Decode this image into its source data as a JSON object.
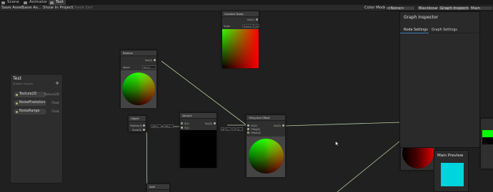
{
  "tabs": [
    {
      "label": "Scene"
    },
    {
      "label": "Animator"
    },
    {
      "label": "Test"
    }
  ],
  "toolbar": {
    "save_asset": "Save Asset",
    "save_as": "Save As...",
    "show_in_project": "Show In Project",
    "check_out": "Check Out",
    "color_mode_label": "Color Mode",
    "color_mode_value": "<None>",
    "blackboard": "Blackboard",
    "graph_inspector": "Graph Inspector",
    "main_preview": "Main Preview"
  },
  "blackboard": {
    "title": "Test",
    "subtitle": "Shader Graphs",
    "add": "+",
    "properties": [
      {
        "name": "Texture2D",
        "type": "Texture2D"
      },
      {
        "name": "NoisePixelation",
        "type": "Float"
      },
      {
        "name": "NoiseRange",
        "type": "Float"
      }
    ]
  },
  "nodes": {
    "gradient_noise": {
      "title": "Gradient Noise",
      "out": "Out(1)",
      "port_in": "Scale",
      "field_value": "Default",
      "field_num": "10"
    },
    "position": {
      "title": "Position",
      "out": "Out(3)",
      "port_in": "Space",
      "field_value": "World"
    },
    "object": {
      "title": "Object",
      "ports": [
        "Position(3)",
        "Scale(3)"
      ]
    },
    "vector": {
      "title": "Vector2",
      "ports": [
        "X(1)",
        "Y(1)"
      ],
      "out": "Out(2)",
      "chips": [
        "X",
        "0",
        "Y",
        "0"
      ]
    },
    "tiling": {
      "title": "Tiling And Offset",
      "ports": [
        "UV(2)",
        "Tiling(2)",
        "Offset(2)"
      ],
      "out": "Out(2)",
      "chips": [
        "X",
        "0",
        "Y",
        "0"
      ]
    },
    "bottom": {
      "title": "Split"
    }
  },
  "inspector": {
    "title": "Graph Inspector",
    "tabs": [
      "Node Settings",
      "Graph Settings"
    ]
  },
  "main_preview": {
    "title": "Main Preview"
  },
  "colors": {
    "edge": "#b5c9a3",
    "accent": "#3a79bb",
    "preview_cyan": "#00d4dd"
  }
}
